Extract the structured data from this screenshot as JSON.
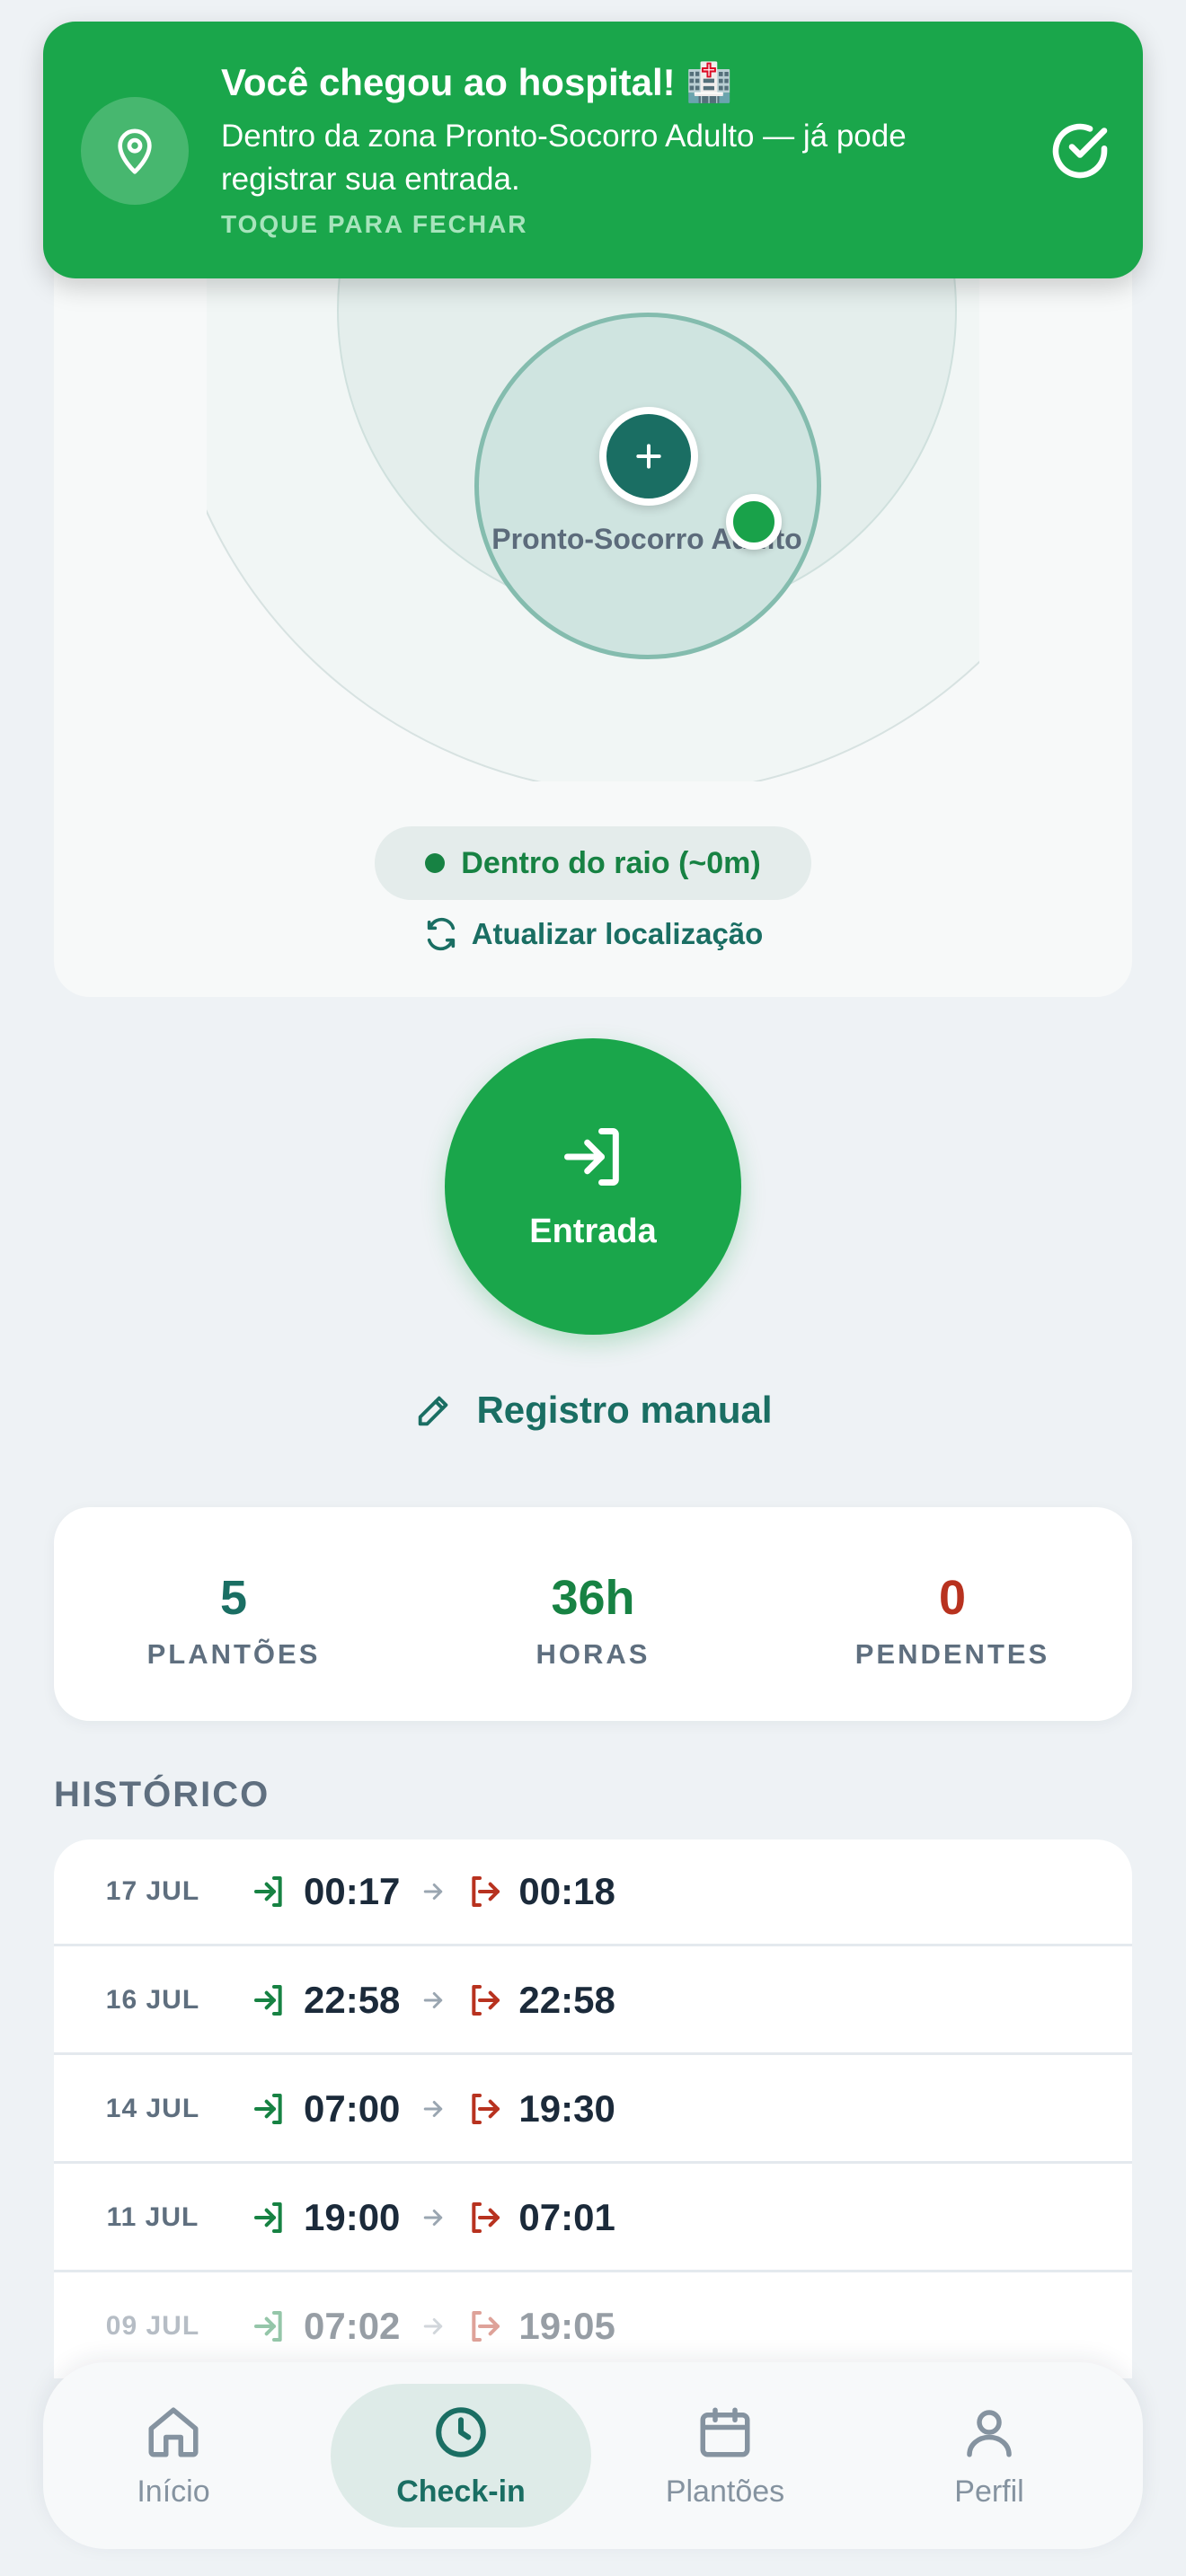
{
  "toast": {
    "title": "Você chegou ao hospital! 🏥",
    "body": "Dentro da zona Pronto-Socorro Adulto — já pode registrar sua entrada.",
    "hint": "TOQUE PARA FECHAR"
  },
  "map": {
    "zone_label": "Pronto-Socorro Adulto",
    "status": "Dentro do raio (~0m)",
    "refresh_label": "Atualizar localização"
  },
  "action": {
    "entrada_label": "Entrada",
    "manual_label": "Registro manual"
  },
  "stats": [
    {
      "value": "5",
      "label": "PLANTÕES",
      "color": "#1a6e63"
    },
    {
      "value": "36h",
      "label": "HORAS",
      "color": "#178243"
    },
    {
      "value": "0",
      "label": "PENDENTES",
      "color": "#b8321f"
    }
  ],
  "history": {
    "title": "HISTÓRICO",
    "rows": [
      {
        "date": "17 JUL",
        "in": "00:17",
        "out": "00:18"
      },
      {
        "date": "16 JUL",
        "in": "22:58",
        "out": "22:58"
      },
      {
        "date": "14 JUL",
        "in": "07:00",
        "out": "19:30"
      },
      {
        "date": "11 JUL",
        "in": "19:00",
        "out": "07:01"
      },
      {
        "date": "09 JUL",
        "in": "07:02",
        "out": "19:05"
      }
    ]
  },
  "nav": {
    "items": [
      {
        "label": "Início",
        "icon": "home-icon"
      },
      {
        "label": "Check-in",
        "icon": "clock-icon",
        "active": true
      },
      {
        "label": "Plantões",
        "icon": "calendar-icon"
      },
      {
        "label": "Perfil",
        "icon": "user-icon"
      }
    ]
  },
  "colors": {
    "primary_green": "#1aa64b",
    "teal": "#1a6e63",
    "danger": "#b8321f"
  }
}
